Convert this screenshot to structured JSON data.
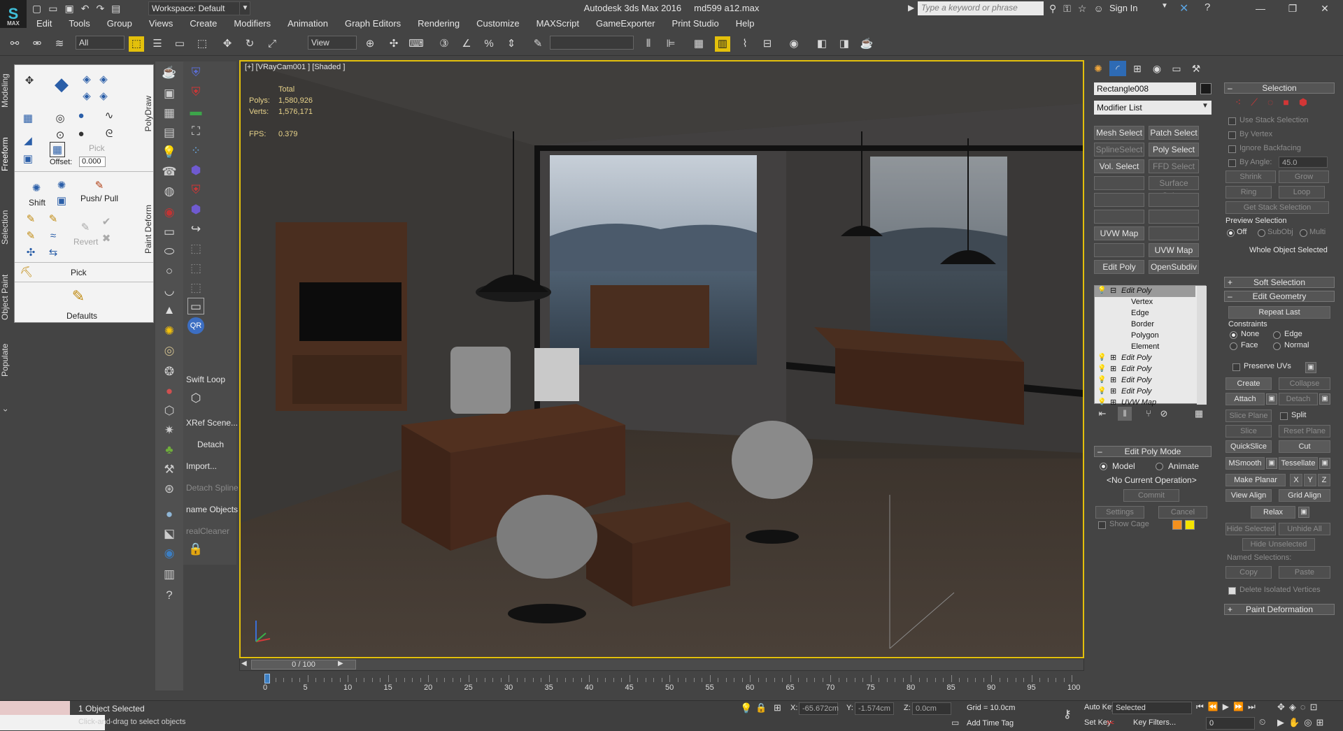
{
  "app": {
    "logo_text": "MAX",
    "title": "Autodesk 3ds Max 2016",
    "file": "md599 a12.max",
    "workspace": "Workspace: Default",
    "search_placeholder": "Type a keyword or phrase",
    "signin": "Sign In"
  },
  "menu": [
    "Edit",
    "Tools",
    "Group",
    "Views",
    "Create",
    "Modifiers",
    "Animation",
    "Graph Editors",
    "Rendering",
    "Customize",
    "MAXScript",
    "GameExporter",
    "Print Studio",
    "Help"
  ],
  "toolbar": {
    "filter": "All",
    "ref_coord": "View",
    "named_sel": ""
  },
  "ribbon": {
    "tabs": [
      "Modeling",
      "Freeform",
      "Selection",
      "Object Paint",
      "Populate"
    ],
    "labels": {
      "pick": "Pick",
      "offset": "Offset:",
      "offset_value": "0.000",
      "shift": "Shift",
      "push_pull": "Push/ Pull",
      "revert": "Revert",
      "pick2": "Pick",
      "defaults": "Defaults",
      "polydraw": "PolyDraw",
      "paint_deform": "Paint Deform"
    }
  },
  "command_column": {
    "labels": [
      "Swift Loop",
      "XRef Scene...",
      "Detach",
      "Import...",
      "Detach Spline",
      "name Objects",
      "realCleaner"
    ],
    "dim_labels": [
      false,
      false,
      false,
      false,
      true,
      false,
      true
    ]
  },
  "viewport": {
    "label": "[+] [VRayCam001 ] [Shaded ]",
    "stats": {
      "total_label": "Total",
      "polys_label": "Polys:",
      "polys": "1,580,926",
      "verts_label": "Verts:",
      "verts": "1,576,171",
      "fps_label": "FPS:",
      "fps": "0.379"
    },
    "colors": {
      "border": "#e3c00b",
      "wall": "#3b3937",
      "floor": "#3e352d",
      "wood": "#4a2e1f",
      "glass": "#8ea2b3"
    }
  },
  "timeline": {
    "frame": "0 / 100",
    "ticks": [
      "0",
      "5",
      "10",
      "15",
      "20",
      "25",
      "30",
      "35",
      "40",
      "45",
      "50",
      "55",
      "60",
      "65",
      "70",
      "75",
      "80",
      "85",
      "90",
      "95",
      "100"
    ]
  },
  "status": {
    "selected_count": "1 Object Selected",
    "prompt": "Click-and-drag to select objects",
    "x_label": "X:",
    "x": "-65.672cm",
    "y_label": "Y:",
    "y": "-1.574cm",
    "z_label": "Z:",
    "z": "0.0cm",
    "grid": "Grid = 10.0cm",
    "add_time_tag": "Add Time Tag",
    "auto_key": "Auto Key",
    "set_key": "Set Key",
    "key_mode": "Selected",
    "key_filters": "Key Filters...",
    "frame_value": "0"
  },
  "command_panel": {
    "object_name": "Rectangle008",
    "modifier_list": "Modifier List",
    "buttons": [
      [
        "Mesh Select",
        "Patch Select"
      ],
      [
        "SplineSelect",
        "Poly Select"
      ],
      [
        "Vol. Select",
        "FFD Select"
      ],
      [
        "",
        "Surface Select"
      ],
      [
        "",
        ""
      ],
      [
        "",
        ""
      ],
      [
        "UVW Map",
        ""
      ],
      [
        "",
        "UVW Map"
      ],
      [
        "Edit Poly",
        "OpenSubdiv"
      ]
    ],
    "dim_buttons": [
      "SplineSelect",
      "FFD Select",
      "Surface Select"
    ],
    "stack": [
      {
        "label": "Edit Poly",
        "level": 0,
        "selected": true
      },
      {
        "label": "Vertex",
        "level": 1
      },
      {
        "label": "Edge",
        "level": 1
      },
      {
        "label": "Border",
        "level": 1
      },
      {
        "label": "Polygon",
        "level": 1
      },
      {
        "label": "Element",
        "level": 1
      },
      {
        "label": "Edit Poly",
        "level": 0
      },
      {
        "label": "Edit Poly",
        "level": 0
      },
      {
        "label": "Edit Poly",
        "level": 0
      },
      {
        "label": "Edit Poly",
        "level": 0
      },
      {
        "label": "UVW Map",
        "level": 0
      }
    ],
    "edit_poly_mode": {
      "title": "Edit Poly Mode",
      "model": "Model",
      "animate": "Animate",
      "current_op": "<No Current Operation>",
      "commit": "Commit",
      "settings": "Settings",
      "cancel": "Cancel",
      "show_cage": "Show Cage",
      "cage_colors": [
        "#f5911e",
        "#f5e400"
      ]
    }
  },
  "selection_panel": {
    "title": "Selection",
    "use_stack": "Use Stack Selection",
    "by_vertex": "By Vertex",
    "ignore_backfacing": "Ignore Backfacing",
    "by_angle": "By Angle:",
    "angle_value": "45.0",
    "shrink": "Shrink",
    "grow": "Grow",
    "ring": "Ring",
    "loop": "Loop",
    "get_stack": "Get Stack Selection",
    "preview_selection": "Preview Selection",
    "off": "Off",
    "subobj": "SubObj",
    "multi": "Multi",
    "whole_object": "Whole Object Selected",
    "soft_selection": "Soft Selection",
    "edit_geometry": "Edit Geometry",
    "repeat_last": "Repeat Last",
    "constraints": "Constraints",
    "none": "None",
    "edge": "Edge",
    "face": "Face",
    "normal": "Normal",
    "preserve_uvs": "Preserve UVs",
    "create": "Create",
    "collapse": "Collapse",
    "attach": "Attach",
    "detach": "Detach",
    "slice_plane": "Slice Plane",
    "split": "Split",
    "slice": "Slice",
    "reset_plane": "Reset Plane",
    "quickslice": "QuickSlice",
    "cut": "Cut",
    "msmooth": "MSmooth",
    "tessellate": "Tessellate",
    "make_planar": "Make Planar",
    "x": "X",
    "y": "Y",
    "z": "Z",
    "view_align": "View Align",
    "grid_align": "Grid Align",
    "relax": "Relax",
    "hide_selected": "Hide Selected",
    "unhide_all": "Unhide All",
    "hide_unselected": "Hide Unselected",
    "named_selections": "Named Selections:",
    "copy": "Copy",
    "paste": "Paste",
    "delete_isolated": "Delete Isolated Vertices",
    "paint_deformation": "Paint Deformation"
  }
}
